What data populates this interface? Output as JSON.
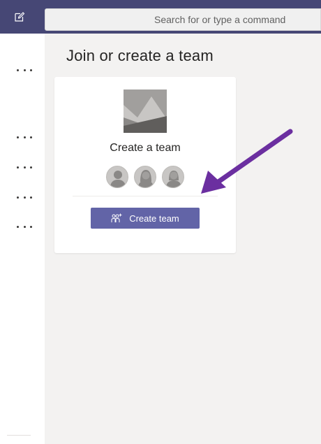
{
  "topbar": {
    "search_placeholder": "Search for or type a command",
    "compose_icon": "compose-icon"
  },
  "leftrail": {
    "items": [
      {
        "icon": "more-options-icon"
      },
      {
        "icon": "more-options-icon"
      },
      {
        "icon": "more-options-icon"
      },
      {
        "icon": "more-options-icon"
      },
      {
        "icon": "more-options-icon"
      }
    ]
  },
  "main": {
    "title": "Join or create a team",
    "card": {
      "title": "Create a team",
      "button_label": "Create team",
      "button_icon": "add-people-icon",
      "image_icon": "team-image-placeholder-icon"
    }
  },
  "annotation": {
    "arrow_color": "#6b2fa0"
  },
  "colors": {
    "topbar": "#464775",
    "accent": "#6264a7",
    "background": "#f3f2f1"
  }
}
